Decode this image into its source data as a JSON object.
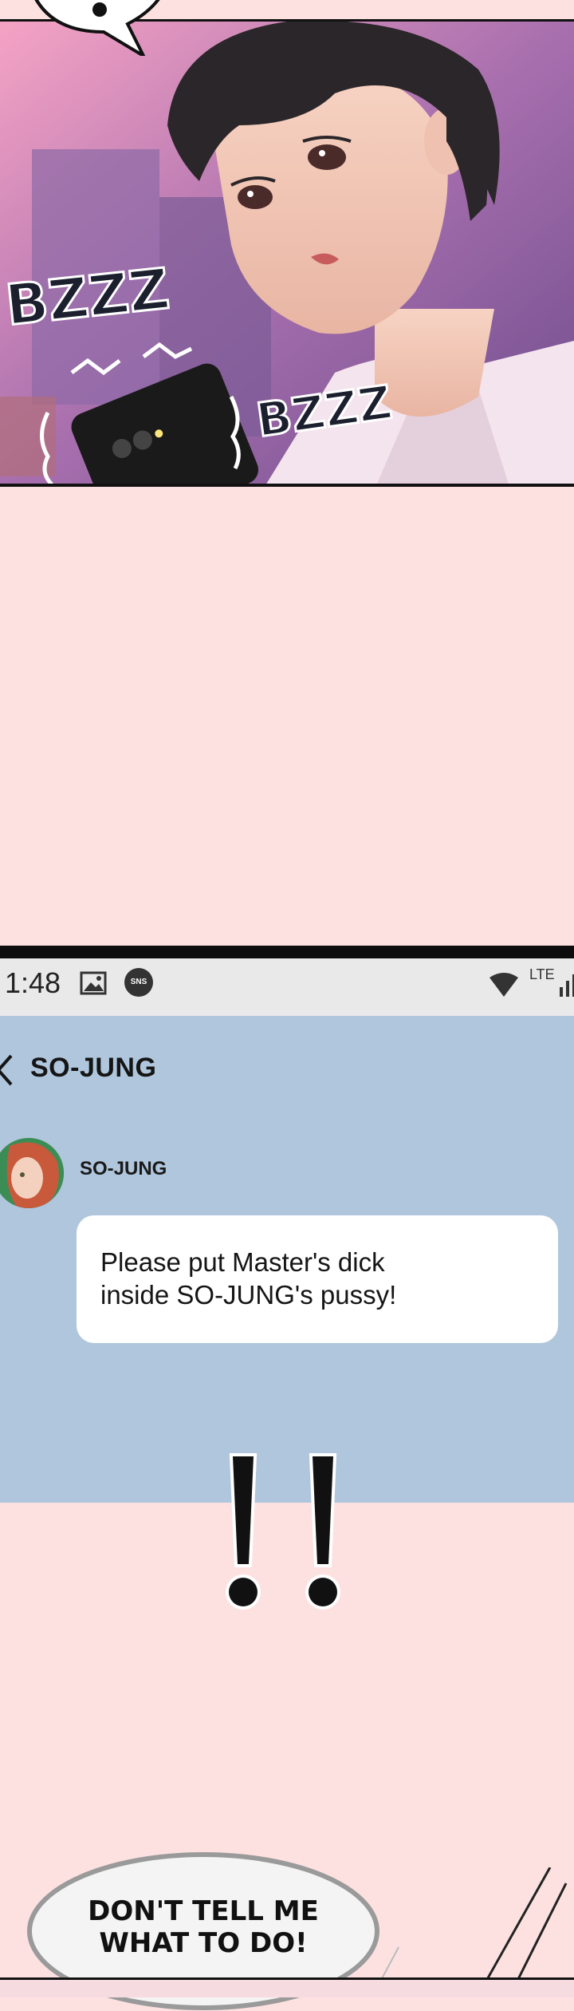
{
  "panel_top": {
    "sfx_left": "BZZZ",
    "sfx_right": "BZZZ"
  },
  "phone": {
    "status_bar": {
      "time": "1:48",
      "sns_badge": "SNS",
      "network": "LTE",
      "icons": [
        "image-icon",
        "sns-icon",
        "wifi-icon",
        "lte-icon",
        "signal-icon"
      ]
    },
    "chat": {
      "title": "SO-JUNG",
      "sender": "SO-JUNG",
      "message": "Please put Master's dick\ninside SO-JUNG's pussy!"
    }
  },
  "exclamation": "!!",
  "bottom_bubble": {
    "text": "DON'T TELL ME\nWHAT TO DO!"
  },
  "colors": {
    "background": "#fde1e1",
    "chat_background": "#b0c6dc",
    "status_bar": "#e9e9e9"
  }
}
